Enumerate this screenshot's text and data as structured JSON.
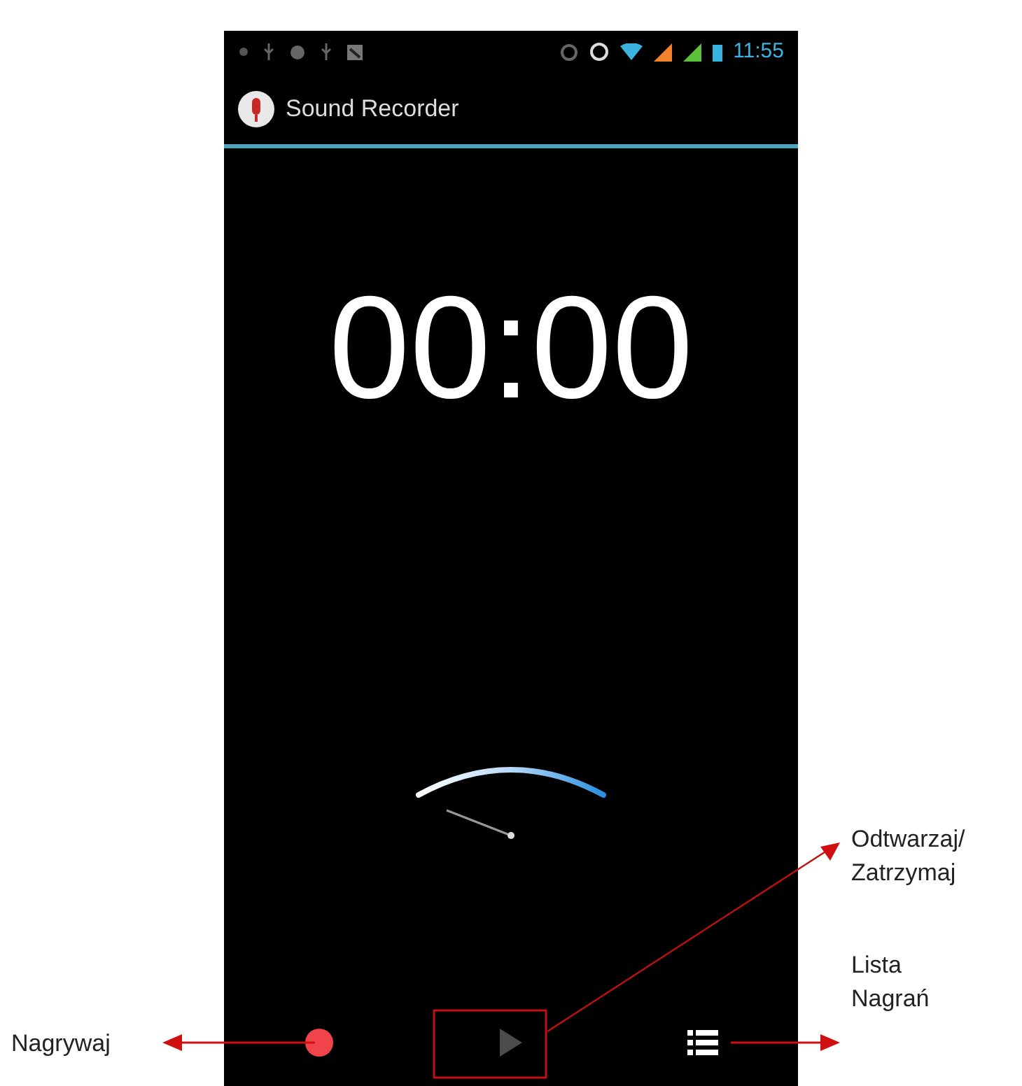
{
  "status_bar": {
    "time": "11:55"
  },
  "app_bar": {
    "title": "Sound Recorder"
  },
  "timer": "00:00",
  "controls": [
    {
      "kind": "record",
      "disabled": false
    },
    {
      "kind": "play",
      "disabled": true
    },
    {
      "kind": "list",
      "disabled": false
    }
  ],
  "annotations": {
    "left": [
      "Nagrywaj"
    ],
    "right_top": [
      "Odtwarzaj/",
      "Zatrzymaj"
    ],
    "right_bottom": [
      "Lista",
      "Nagrań"
    ]
  }
}
